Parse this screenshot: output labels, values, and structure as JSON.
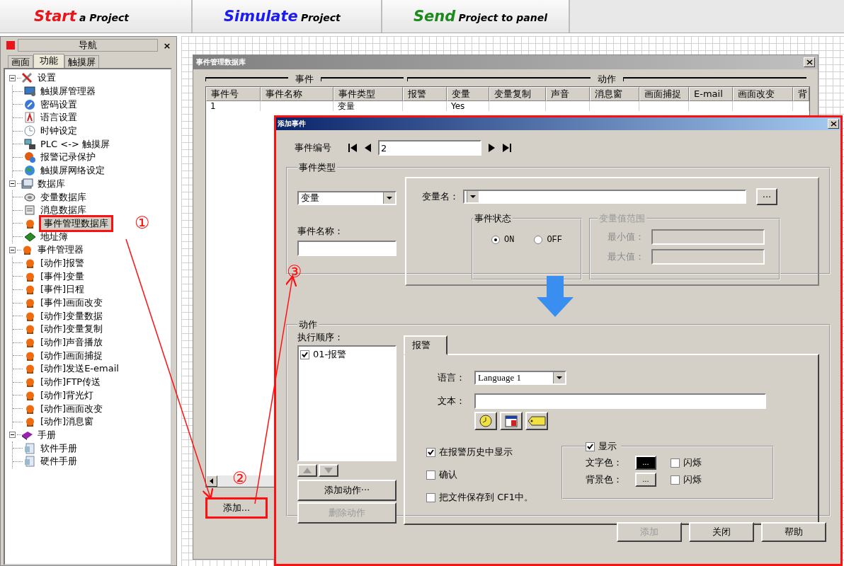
{
  "toolbar": [
    {
      "keyword": "Start",
      "text": "a Project",
      "color": "#e8161b"
    },
    {
      "keyword": "Simulate",
      "text": "Project",
      "color": "#1c1cf0"
    },
    {
      "keyword": "Send",
      "text": "Project to panel",
      "color": "#1e8a1e"
    }
  ],
  "navigator": {
    "title": "导航",
    "close": "×",
    "tabs": [
      {
        "label": "画面",
        "selected": false
      },
      {
        "label": "功能",
        "selected": true
      },
      {
        "label": "触摸屏",
        "selected": false
      }
    ],
    "tree": [
      {
        "label": "设置",
        "kind": "tools",
        "expanded": true,
        "selected": false,
        "children": [
          {
            "label": "触摸屏管理器",
            "kind": "monitor",
            "selected": false
          },
          {
            "label": "密码设置",
            "kind": "key",
            "selected": false
          },
          {
            "label": "语言设置",
            "kind": "font",
            "selected": false
          },
          {
            "label": "时钟设定",
            "kind": "clock",
            "selected": false
          },
          {
            "label": "PLC <-> 触摸屏",
            "kind": "network",
            "selected": false
          },
          {
            "label": "报警记录保护",
            "kind": "alarm",
            "selected": false
          },
          {
            "label": "触摸屏网络设定",
            "kind": "globe",
            "selected": false
          }
        ]
      },
      {
        "label": "数据库",
        "kind": "database",
        "expanded": true,
        "selected": false,
        "children": [
          {
            "label": "变量数据库",
            "kind": "variable",
            "selected": false
          },
          {
            "label": "消息数据库",
            "kind": "message",
            "selected": false
          },
          {
            "label": "事件管理数据库",
            "kind": "event",
            "selected": true,
            "callout": true
          },
          {
            "label": "地址簿",
            "kind": "book",
            "selected": false
          }
        ]
      },
      {
        "label": "事件管理器",
        "kind": "event",
        "expanded": true,
        "selected": false,
        "children": [
          {
            "label": "[动作]报警",
            "kind": "event",
            "selected": false
          },
          {
            "label": "[事件]变量",
            "kind": "event",
            "selected": false
          },
          {
            "label": "[事件]日程",
            "kind": "event",
            "selected": false
          },
          {
            "label": "[事件]画面改变",
            "kind": "event",
            "selected": false
          },
          {
            "label": "[动作]变量数据",
            "kind": "event",
            "selected": false
          },
          {
            "label": "[动作]变量复制",
            "kind": "event",
            "selected": false
          },
          {
            "label": "[动作]声音播放",
            "kind": "event",
            "selected": false
          },
          {
            "label": "[动作]画面捕捉",
            "kind": "event",
            "selected": false
          },
          {
            "label": "[动作]发送E-email",
            "kind": "event",
            "selected": false
          },
          {
            "label": "[动作]FTP传送",
            "kind": "event",
            "selected": false
          },
          {
            "label": "[动作]背光灯",
            "kind": "event",
            "selected": false
          },
          {
            "label": "[动作]画面改变",
            "kind": "event",
            "selected": false
          },
          {
            "label": "[动作]消息窗",
            "kind": "event",
            "selected": false
          }
        ]
      },
      {
        "label": "手册",
        "kind": "manual",
        "expanded": true,
        "selected": false,
        "children": [
          {
            "label": "软件手册",
            "kind": "doc",
            "selected": false
          },
          {
            "label": "硬件手册",
            "kind": "doc",
            "selected": false
          }
        ]
      }
    ]
  },
  "event_database": {
    "title": "事件管理数据库",
    "groups": [
      "事件",
      "动作"
    ],
    "columns": [
      "事件号",
      "事件名称",
      "事件类型",
      "报警",
      "变量",
      "变量复制",
      "声音",
      "消息窗",
      "画面捕捉",
      "E-mail",
      "画面改变",
      "背"
    ],
    "rows": [
      {
        "cells": [
          "1",
          null,
          "变量",
          null,
          "Yes"
        ]
      }
    ],
    "add_button": {
      "label": "添加...",
      "callout": true
    }
  },
  "add_event": {
    "title": "添加事件",
    "callout": true,
    "number_label": "事件编号",
    "number_value": "2",
    "event_type": {
      "title": "事件类型",
      "type_value": "变量",
      "name_label": "事件名称：",
      "variable_label": "变量名：",
      "browse": "···",
      "state": {
        "title": "事件状态",
        "options": [
          {
            "label": "ON",
            "selected": true
          },
          {
            "label": "OFF",
            "selected": false
          }
        ]
      },
      "range": {
        "title": "变量值范围",
        "disabled": true,
        "min_label": "最小值：",
        "max_label": "最大值："
      }
    },
    "actions": {
      "title": "动作",
      "order_label": "执行顺序：",
      "items": [
        {
          "label": "01-报警",
          "checked": true
        }
      ],
      "add_action": "添加动作···",
      "delete_action": {
        "label": "删除动作",
        "disabled": true
      },
      "tabs": [
        {
          "label": "报警",
          "selected": true
        }
      ],
      "language_label": "语言：",
      "language_value": "Language 1",
      "text_label": "文本：",
      "options": [
        {
          "label": "在报警历史中显示",
          "checked": true
        },
        {
          "label": "确认",
          "checked": false
        },
        {
          "label": "把文件保存到 CF1中。",
          "checked": false
        }
      ],
      "display": {
        "label": "显示",
        "checked": true,
        "rows": [
          {
            "label": "文字色：",
            "color": "#000000",
            "swatch": "...",
            "blink": {
              "label": "闪烁",
              "checked": false
            }
          },
          {
            "label": "背景色：",
            "color": "#d4d0c8",
            "swatch": "...",
            "blink": {
              "label": "闪烁",
              "checked": false
            }
          }
        ]
      }
    },
    "buttons": [
      {
        "label": "添加",
        "disabled": true
      },
      {
        "label": "关闭",
        "disabled": false
      },
      {
        "label": "帮助",
        "disabled": false
      }
    ]
  },
  "annotations": {
    "markers": [
      "①",
      "②",
      "③"
    ]
  }
}
